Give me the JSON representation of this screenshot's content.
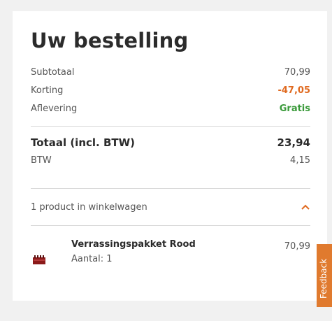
{
  "order": {
    "title": "Uw bestelling",
    "subtotal_label": "Subtotaal",
    "subtotal_value": "70,99",
    "discount_label": "Korting",
    "discount_value": "-47,05",
    "delivery_label": "Aflevering",
    "delivery_value": "Gratis",
    "total_label": "Totaal (incl. BTW)",
    "total_value": "23,94",
    "vat_label": "BTW",
    "vat_value": "4,15"
  },
  "cart": {
    "summary_label": "1 product in winkelwagen",
    "toggle_icon": "chevron-up-icon",
    "items": [
      {
        "name": "Verrassingspakket Rood",
        "quantity": "Aantal: 1",
        "price": "70,99",
        "image": "red-wine-package"
      }
    ]
  },
  "feedback": {
    "label": "Feedback"
  },
  "colors": {
    "accent": "#e06a20",
    "free": "#3a9a3a",
    "feedback_bg": "#e07a2e",
    "product_thumb": "#8b1a1a"
  }
}
